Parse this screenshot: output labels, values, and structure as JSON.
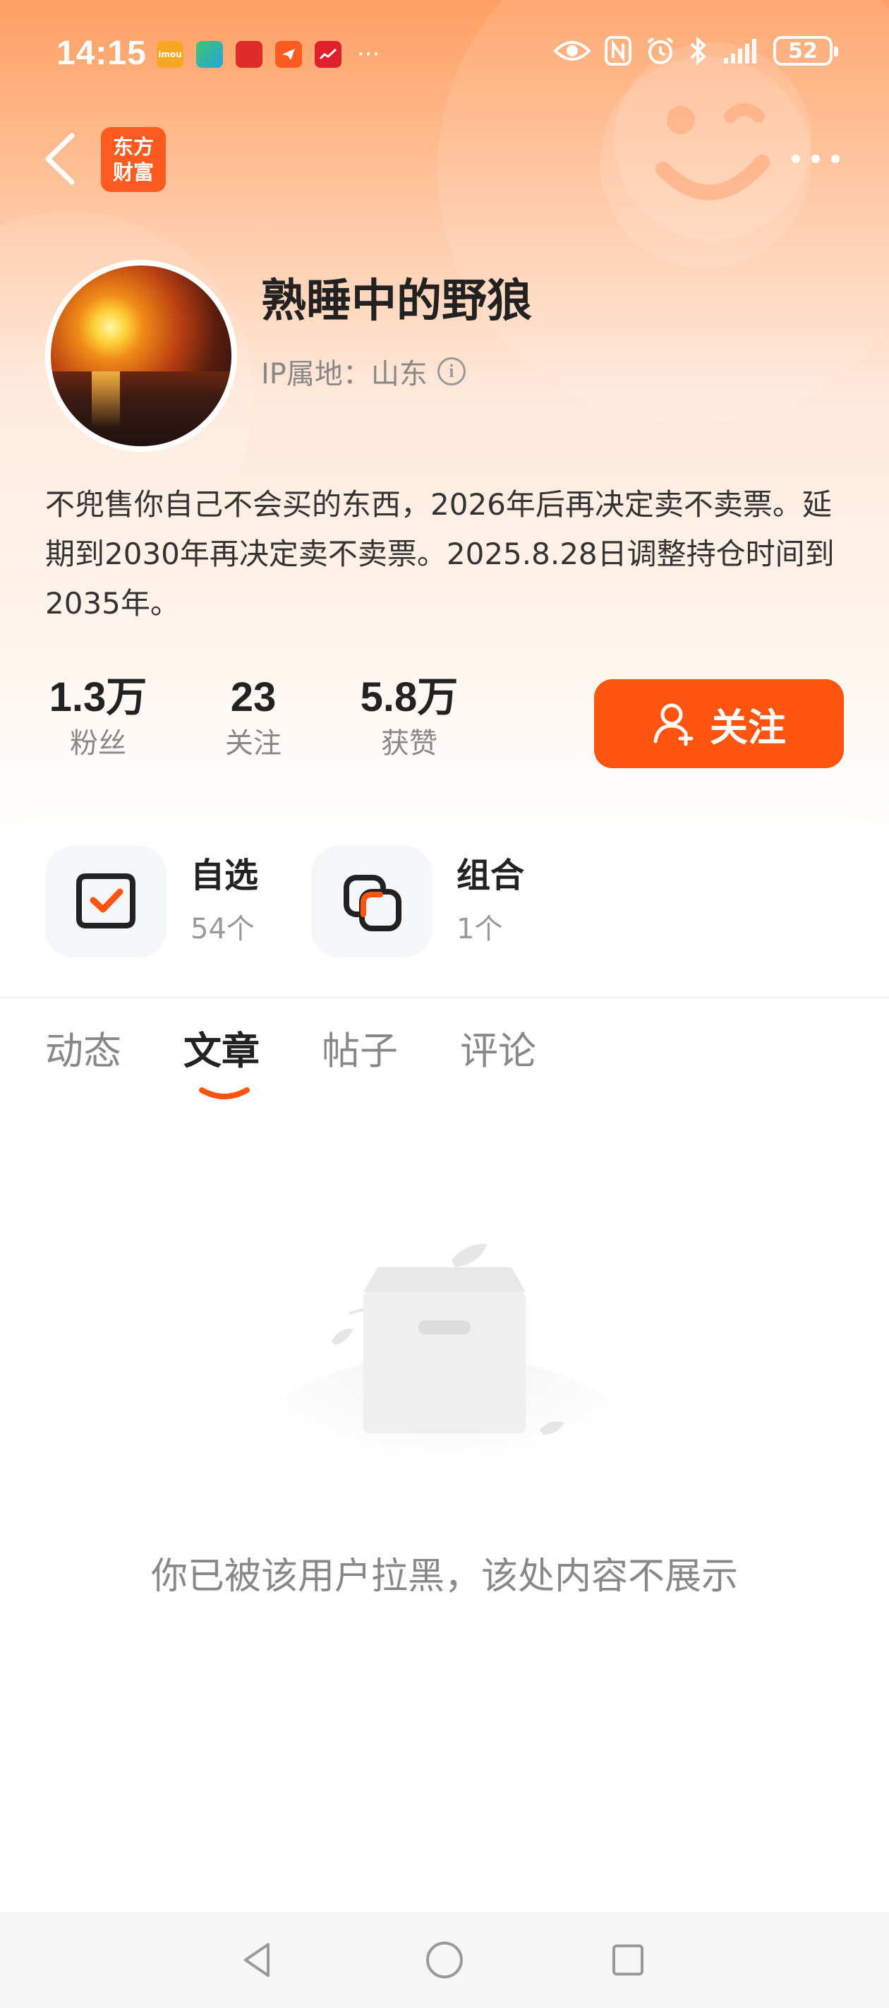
{
  "status_bar": {
    "time": "14:15",
    "notification_icons": [
      "imou-app-icon",
      "maps-app-icon",
      "bank-app-icon",
      "message-app-icon",
      "stock-app-icon"
    ],
    "more_notifications": "···",
    "battery_level": "52"
  },
  "header": {
    "brand_line1": "东方",
    "brand_line2": "财富"
  },
  "profile": {
    "username": "熟睡中的野狼",
    "ip_location": "IP属地：山东",
    "bio": "不兜售你自己不会买的东西，2026年后再决定卖不卖票。延期到2030年再决定卖不卖票。2025.8.28日调整持仓时间到2035年。"
  },
  "stats": [
    {
      "value": "1.3万",
      "label": "粉丝"
    },
    {
      "value": "23",
      "label": "关注"
    },
    {
      "value": "5.8万",
      "label": "获赞"
    }
  ],
  "follow_button": {
    "label": "关注"
  },
  "quick_links": [
    {
      "title": "自选",
      "count": "54个"
    },
    {
      "title": "组合",
      "count": "1个"
    }
  ],
  "tabs": [
    {
      "label": "动态",
      "active": false
    },
    {
      "label": "文章",
      "active": true
    },
    {
      "label": "帖子",
      "active": false
    },
    {
      "label": "评论",
      "active": false
    }
  ],
  "empty_state": {
    "message": "你已被该用户拉黑，该处内容不展示"
  },
  "colors": {
    "accent": "#ff5511",
    "header_gradient_top": "#ff9f63"
  }
}
